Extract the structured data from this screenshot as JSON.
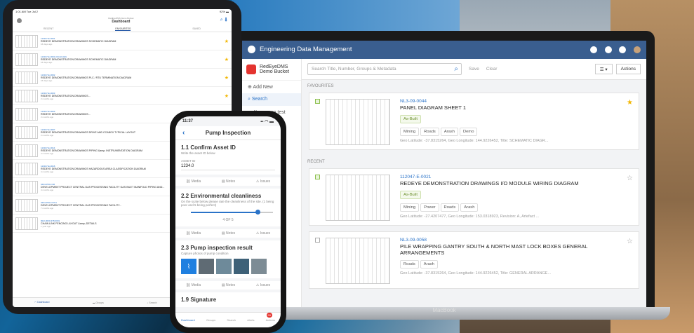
{
  "ipad": {
    "status_time": "1:01 AM  Tue Jul 2",
    "status_battery": "92% ▬",
    "subtitle": "RedEyeDMS Demo Bucket",
    "title": "Dashboard",
    "tabs": [
      "RECENT",
      "FAVOURITES",
      "SAVED"
    ],
    "rows": [
      {
        "id": "113347-E-0001",
        "name": "REDEYE DEMONSTRATION DRAWINGS SCHEMATIC DIAGRAM",
        "date": "16 days ago",
        "star": true
      },
      {
        "id": "113347-E-0001 (03-02-022)",
        "name": "REDEYE DEMONSTRATION DRAWINGS SCHEMATIC DIAGRAM",
        "date": "16 days ago",
        "star": true
      },
      {
        "id": "113347-E-0002",
        "name": "REDEYE DEMONSTRATION DRAWINGS PLC / RTU TERMINATION DIAGRAM",
        "date": "16 days ago",
        "star": true
      },
      {
        "id": "113347-E-0003",
        "name": "REDEYE DEMONSTRATION DRAWINGS...",
        "date": "2 months ago",
        "star": true
      },
      {
        "id": "113347-E-0003",
        "name": "REDEYE DEMONSTRATION DRAWINGS...",
        "date": "2 months ago",
        "star": true
      },
      {
        "id": "113347-E-0007",
        "name": "REDEYE DEMONSTRATION DRAWINGS DRIVE AND CCABOX TYPICAL LAYOUT",
        "date": "2 months ago",
        "star": true
      },
      {
        "id": "113347-E-0014",
        "name": "REDEYE DEMONSTRATION DRAWINGS PIPING &amp; INSTRUMENTATION DIAGRAM",
        "date": "4 months ago",
        "star": true
      },
      {
        "id": "113347-E-0016",
        "name": "REDEYE DEMONSTRATION DRAWINGS HAZARDOUS AREA CLASSIFICATION DIAGRAM",
        "date": "4 months ago",
        "star": true
      },
      {
        "id": "0404-PRO-156",
        "name": "DEVELOPMENT PROJECT CENTRAL GAS PROCESSING FACILITY GAS INLET MANIFOLD PIPING AND...",
        "date": "4 months ago",
        "star": true
      },
      {
        "id": "0404-PRO-157-9",
        "name": "DEVELOPMENT PROJECT CENTRAL GAS PROCESSING FACILITY...",
        "date": "7 months ago",
        "star": true
      },
      {
        "id": "RE3-0000-378-0001",
        "name": "CHAIN LINK FENCING LAYOUT &amp; DETAILS",
        "date": "1 year ago",
        "star": true
      }
    ],
    "tabbar": [
      "Dashboard",
      "Groups",
      "Search",
      "Alerts"
    ]
  },
  "laptop": {
    "app_title": "Engineering Data Management",
    "bucket": "RedEyeDMS\nDemo Bucket",
    "add_new": "Add New",
    "search_nav": "Search",
    "key_group": "Key group test",
    "search_placeholder": "Search Title, Number, Groups & Metadata",
    "save_label": "Save",
    "clear_label": "Clear",
    "actions_label": "Actions",
    "favourites_label": "FAVOURITES",
    "recent_label": "RECENT",
    "macbook_label": "MacBook",
    "cards": [
      {
        "id": "NL3-09-0044",
        "title": "PANEL DIAGRAM SHEET 1",
        "status": "As-Built",
        "tags": [
          "Mining",
          "Roads",
          "Arash",
          "Demo"
        ],
        "meta": "Geo Latitude: -37.8315264, Geo Longitude: 144.9226452, Title: SCHEMATIC DIAGR...",
        "star": true,
        "checked": true
      },
      {
        "id": "112047-E-0021",
        "title": "REDEYE DEMONSTRATION DRAWINGS I/O MODULE WIRING DIAGRAM",
        "status": "As-Built",
        "tags": [
          "Mining",
          "Power",
          "Roads",
          "Arash"
        ],
        "meta": "Geo Latitude: -27.4207477, Geo Longitude: 153.0318923, Revision: A, Artefact ...",
        "star": false,
        "checked": true
      },
      {
        "id": "NL3-09-0058",
        "title": "PILE WRAPPING GANTRY SOUTH & NORTH MAST LOCK BOXES GENERAL ARRANGEMENTS",
        "status": "",
        "tags": [
          "Roads",
          "Arash"
        ],
        "meta": "Geo Latitude: -37.8315264, Geo Longitude: 144.9226452, Title: GENERAL ARRANGE...",
        "star": false,
        "checked": false
      }
    ]
  },
  "phone": {
    "time": "11:37",
    "title": "Pump Inspection",
    "s1_title": "1.1 Confirm Asset ID",
    "s1_hint": "Write the asset ID below",
    "s1_label": "ASSET ID",
    "s1_value": "1234.0",
    "actions": [
      "Media",
      "Notes",
      "Issues"
    ],
    "s2_title": "2.2 Environmental cleanliness",
    "s2_hint": "On the scale below please rate the cleanliness of the site. (1 being poor and 5 being perfect)",
    "s2_value": "4 OF 5",
    "s2_level": 0.8,
    "s3_title": "2.3 Pump inspection result",
    "s3_hint": "Capture photos of pump condition",
    "s4_title": "1.9 Signature",
    "tabbar": [
      "Dashboard",
      "Groups",
      "Search",
      "Alerts",
      "Actions"
    ],
    "notif_count": "99"
  }
}
